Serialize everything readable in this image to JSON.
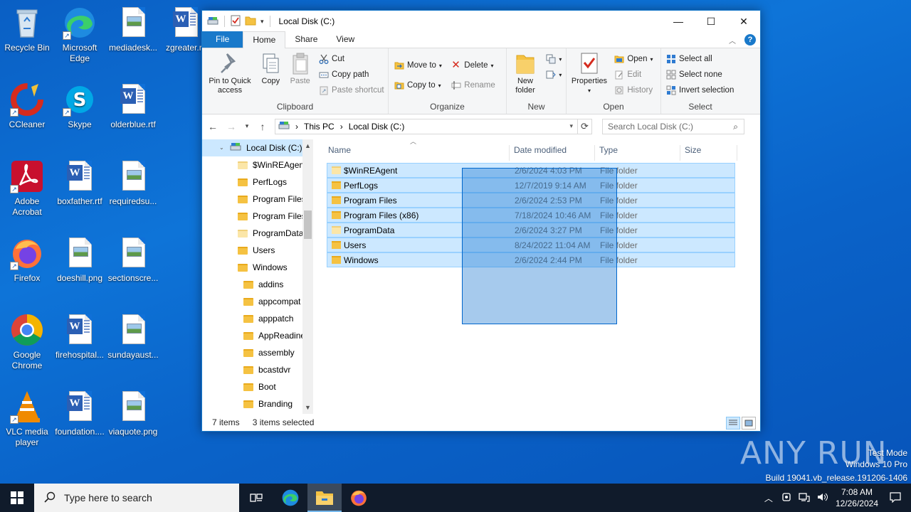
{
  "desktop": {
    "icons": [
      {
        "label": "Recycle Bin"
      },
      {
        "label": "Microsoft Edge"
      },
      {
        "label": "mediadesk..."
      },
      {
        "label": "zgreater.r"
      },
      {
        "label": "CCleaner"
      },
      {
        "label": "Skype"
      },
      {
        "label": "olderblue.rtf"
      },
      {
        "label": "Adobe Acrobat"
      },
      {
        "label": "boxfather.rtf"
      },
      {
        "label": "requiredsu..."
      },
      {
        "label": "Firefox"
      },
      {
        "label": "doeshill.png"
      },
      {
        "label": "sectionscre..."
      },
      {
        "label": "Google Chrome"
      },
      {
        "label": "firehospital..."
      },
      {
        "label": "sundayaust..."
      },
      {
        "label": "VLC media player"
      },
      {
        "label": "foundation...."
      },
      {
        "label": "viaquote.png"
      }
    ]
  },
  "window": {
    "title": "Local Disk (C:)",
    "controls": {
      "minimize": "—",
      "maximize": "☐",
      "close": "✕"
    },
    "tabs": [
      {
        "label": "File"
      },
      {
        "label": "Home"
      },
      {
        "label": "Share"
      },
      {
        "label": "View"
      }
    ],
    "ribbon": {
      "clipboard": {
        "label": "Clipboard",
        "pin": "Pin to Quick access",
        "copy": "Copy",
        "paste": "Paste",
        "cut": "Cut",
        "copy_path": "Copy path",
        "paste_shortcut": "Paste shortcut"
      },
      "organize": {
        "label": "Organize",
        "move_to": "Move to",
        "copy_to": "Copy to",
        "delete": "Delete",
        "rename": "Rename"
      },
      "new": {
        "label": "New",
        "new_folder": "New folder"
      },
      "open": {
        "label": "Open",
        "properties": "Properties",
        "open": "Open",
        "edit": "Edit",
        "history": "History"
      },
      "select": {
        "label": "Select",
        "select_all": "Select all",
        "select_none": "Select none",
        "invert": "Invert selection"
      }
    },
    "address": {
      "crumbs": [
        "This PC",
        "Local Disk (C:)"
      ],
      "search_placeholder": "Search Local Disk (C:)"
    },
    "navpane": {
      "items": [
        {
          "label": "Local Disk (C:)",
          "selected": true
        },
        {
          "label": "$WinREAgent"
        },
        {
          "label": "PerfLogs"
        },
        {
          "label": "Program Files"
        },
        {
          "label": "Program Files"
        },
        {
          "label": "ProgramData"
        },
        {
          "label": "Users"
        },
        {
          "label": "Windows"
        },
        {
          "label": "addins"
        },
        {
          "label": "appcompat"
        },
        {
          "label": "apppatch"
        },
        {
          "label": "AppReadine"
        },
        {
          "label": "assembly"
        },
        {
          "label": "bcastdvr"
        },
        {
          "label": "Boot"
        },
        {
          "label": "Branding"
        }
      ]
    },
    "columns": {
      "name": "Name",
      "date": "Date modified",
      "type": "Type",
      "size": "Size"
    },
    "files": [
      {
        "name": "$WinREAgent",
        "date": "2/6/2024 4:03 PM",
        "type": "File folder"
      },
      {
        "name": "PerfLogs",
        "date": "12/7/2019 9:14 AM",
        "type": "File folder"
      },
      {
        "name": "Program Files",
        "date": "2/6/2024 2:53 PM",
        "type": "File folder"
      },
      {
        "name": "Program Files (x86)",
        "date": "7/18/2024 10:46 AM",
        "type": "File folder"
      },
      {
        "name": "ProgramData",
        "date": "2/6/2024 3:27 PM",
        "type": "File folder"
      },
      {
        "name": "Users",
        "date": "8/24/2022 11:04 AM",
        "type": "File folder"
      },
      {
        "name": "Windows",
        "date": "2/6/2024 2:44 PM",
        "type": "File folder"
      }
    ],
    "status": {
      "count": "7 items",
      "selected": "3 items selected"
    }
  },
  "watermark": {
    "logo": "ANY RUN",
    "line1": "Test Mode",
    "line2": "Windows 10 Pro",
    "line3": "Build 19041.vb_release.191206-1406"
  },
  "taskbar": {
    "search_placeholder": "Type here to search",
    "time": "7:08 AM",
    "date": "12/26/2024"
  }
}
